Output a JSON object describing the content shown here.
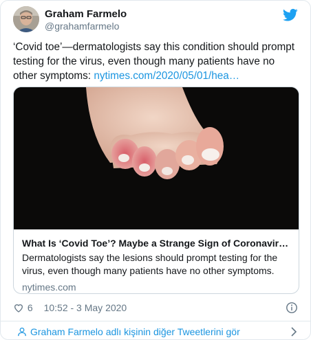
{
  "author": {
    "display_name": "Graham Farmelo",
    "handle": "@grahamfarmelo"
  },
  "tweet": {
    "text": "‘Covid toe’—dermatologists say this condition should prompt testing for the virus, even though many patients have no other symptoms: ",
    "link_text": "nytimes.com/2020/05/01/hea…"
  },
  "card": {
    "title": "What Is ‘Covid Toe’? Maybe a Strange Sign of Coronavirus Inf…",
    "description": "Dermatologists say the lesions should prompt testing for the virus, even though many patients have no other symptoms.",
    "domain": "nytimes.com"
  },
  "meta": {
    "likes": "6",
    "timestamp": "10:52 - 3 May 2020"
  },
  "footer": {
    "more_tweets": "Graham Farmelo adlı kişinin diğer Tweetlerini gör"
  },
  "colors": {
    "link": "#1b95e0",
    "twitter_blue": "#1da1f2",
    "secondary_text": "#657786",
    "border": "#e1e8ed"
  },
  "icons": [
    "twitter-bird-icon",
    "heart-icon",
    "info-icon",
    "person-icon",
    "chevron-right-icon"
  ]
}
